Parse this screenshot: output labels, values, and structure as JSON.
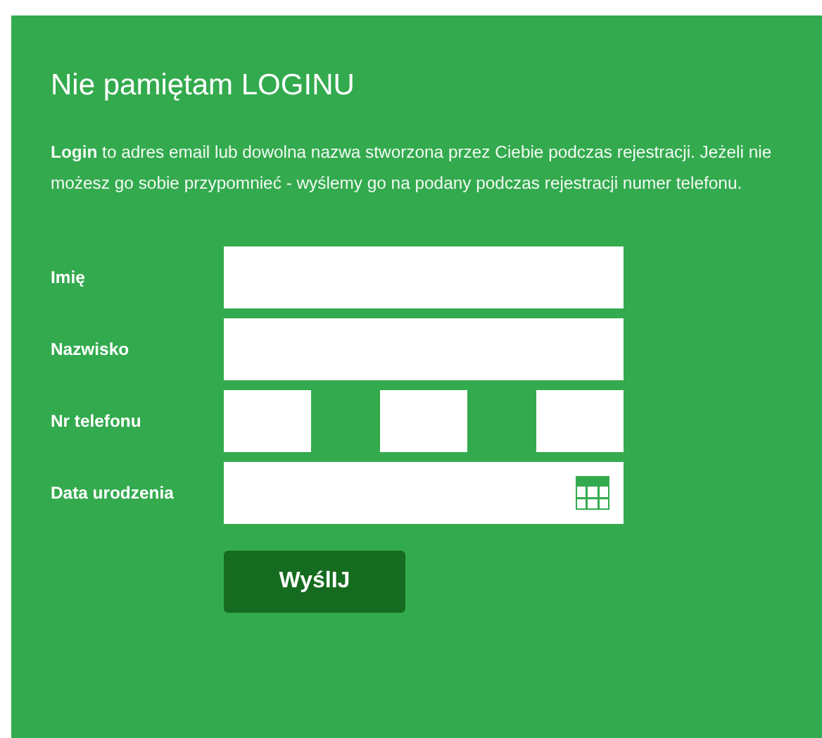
{
  "title": "Nie pamiętam LOGINU",
  "description": "**Login** to adres email lub dowolna nazwa stworzona przez Ciebie podczas rejestracji. Jeżeli nie możesz go sobie przypomnieć - wyślemy go na podany podczas rejestracji numer telefonu.",
  "fields": [
    {
      "label": "Imię",
      "kind": "text"
    },
    {
      "label": "Nazwisko",
      "kind": "text"
    },
    {
      "label": "Nr telefonu",
      "kind": "phone"
    },
    {
      "label": "Data urodzenia",
      "kind": "date"
    }
  ],
  "submit_button": "WyślIJ"
}
